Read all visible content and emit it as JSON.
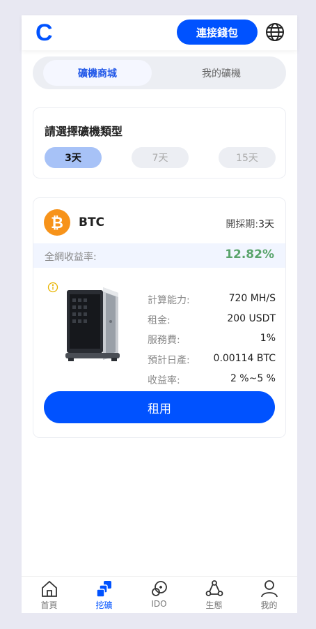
{
  "header": {
    "logo_letter": "C",
    "connect_label": "連接錢包"
  },
  "tabs": [
    {
      "label": "礦機商城",
      "active": true
    },
    {
      "label": "我的礦機",
      "active": false
    }
  ],
  "type_select": {
    "title": "請選擇礦機類型",
    "options": [
      {
        "label": "3天",
        "selected": true
      },
      {
        "label": "7天",
        "selected": false
      },
      {
        "label": "15天",
        "selected": false
      }
    ]
  },
  "product": {
    "coin": "BTC",
    "period_label": "開採期:",
    "period_value": "3天",
    "yield_label": "全網收益率:",
    "yield_value": "12.82%",
    "specs": [
      {
        "label": "計算能力:",
        "value": "720 MH/S"
      },
      {
        "label": "租金:",
        "value": "200 USDT"
      },
      {
        "label": "服務費:",
        "value": "1%"
      },
      {
        "label": "預計日產:",
        "value": "0.00114 BTC"
      },
      {
        "label": "收益率:",
        "value": "2 %~5 %"
      }
    ],
    "rent_label": "租用"
  },
  "bottom_nav": [
    {
      "label": "首頁",
      "icon": "home-icon",
      "active": false
    },
    {
      "label": "挖礦",
      "icon": "mining-icon",
      "active": true
    },
    {
      "label": "IDO",
      "icon": "ido-icon",
      "active": false
    },
    {
      "label": "生態",
      "icon": "ecosystem-icon",
      "active": false
    },
    {
      "label": "我的",
      "icon": "user-icon",
      "active": false
    }
  ],
  "colors": {
    "accent": "#0052ff",
    "yield_green": "#5aa46c",
    "bitcoin_orange": "#f7931a"
  }
}
